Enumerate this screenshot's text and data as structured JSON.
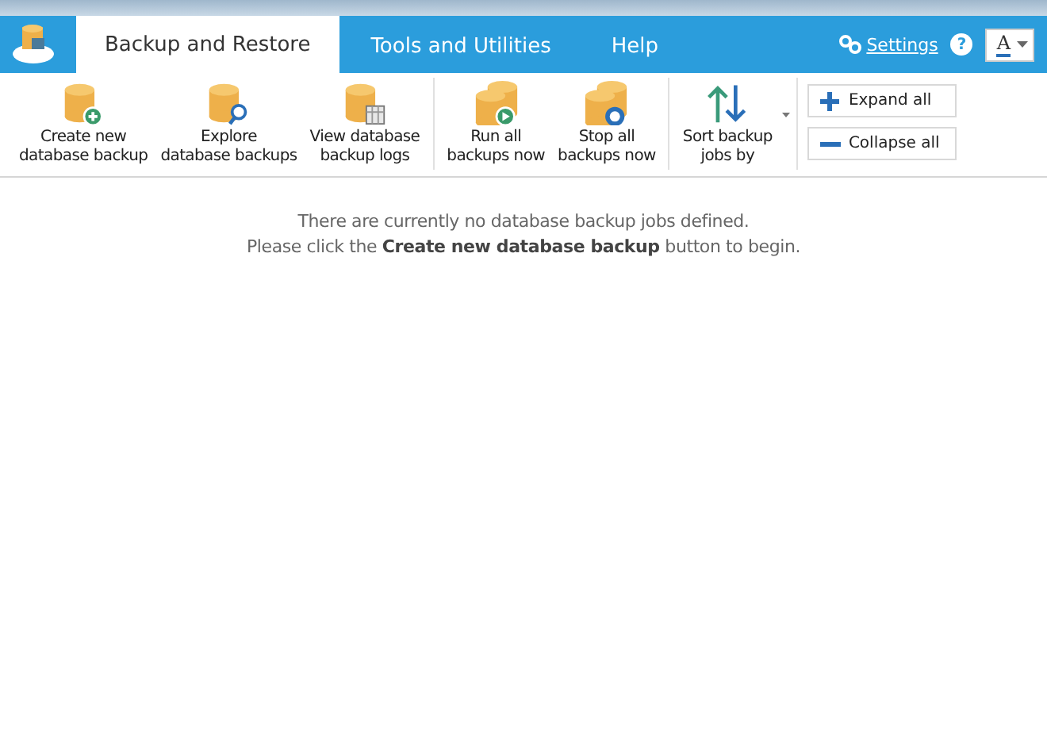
{
  "tabs": [
    {
      "label": "Backup and Restore",
      "selected": true
    },
    {
      "label": "Tools and Utilities",
      "selected": false
    },
    {
      "label": "Help",
      "selected": false
    }
  ],
  "header": {
    "settings": "Settings",
    "help": "?",
    "font_button": "A"
  },
  "ribbon": {
    "groups": [
      {
        "buttons": [
          {
            "kind": "create",
            "lines": [
              "Create new",
              "database backup"
            ]
          },
          {
            "kind": "explore",
            "lines": [
              "Explore",
              "database backups"
            ]
          },
          {
            "kind": "logs",
            "lines": [
              "View database",
              "backup logs"
            ]
          }
        ]
      },
      {
        "buttons": [
          {
            "kind": "run",
            "lines": [
              "Run all",
              "backups now"
            ]
          },
          {
            "kind": "stop",
            "lines": [
              "Stop all",
              "backups now"
            ]
          }
        ]
      },
      {
        "buttons": [
          {
            "kind": "sort",
            "lines": [
              "Sort backup",
              "jobs by"
            ],
            "dropdown": true
          }
        ]
      }
    ],
    "side_buttons": [
      {
        "kind": "expand",
        "label": "Expand all"
      },
      {
        "kind": "collapse",
        "label": "Collapse all"
      }
    ]
  },
  "message": {
    "line_1": "There are currently no database backup jobs defined.",
    "line_2": "Please click the **Create new database backup** button to begin."
  }
}
